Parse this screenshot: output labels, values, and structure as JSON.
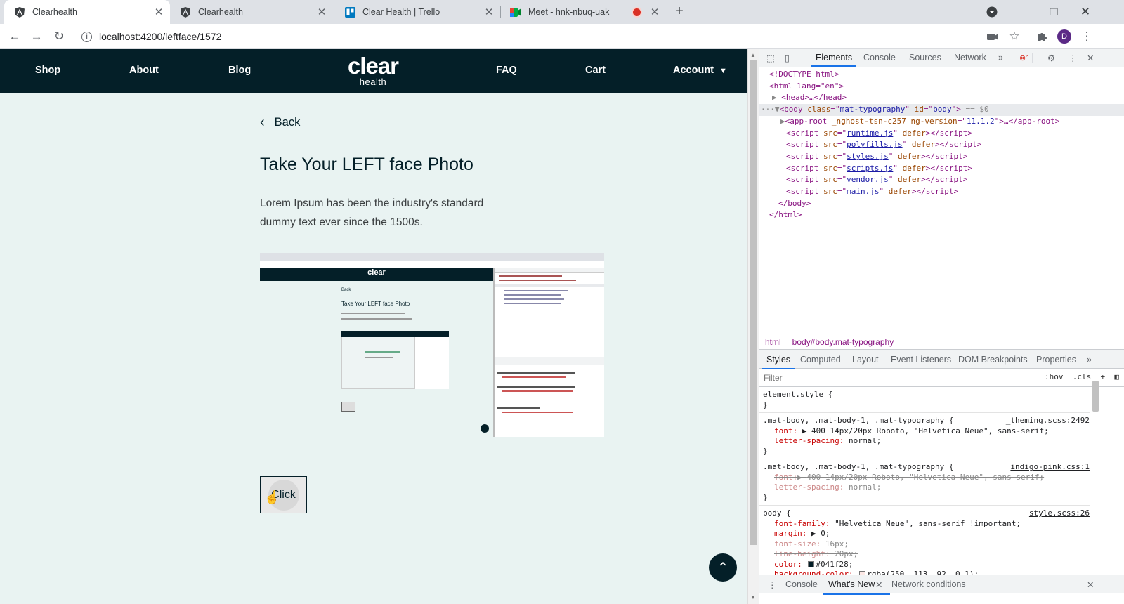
{
  "browser": {
    "tabs": [
      {
        "title": "Clearhealth",
        "active": true
      },
      {
        "title": "Clearhealth",
        "active": false
      },
      {
        "title": "Clear Health | Trello",
        "active": false
      },
      {
        "title": "Meet - hnk-nbuq-uak",
        "active": false,
        "recording": true
      }
    ],
    "url": "localhost:4200/leftface/1572",
    "profile_initial": "D"
  },
  "site": {
    "nav": {
      "shop": "Shop",
      "about": "About",
      "blog": "Blog",
      "logo_main": "clear",
      "logo_sub": "health",
      "faq": "FAQ",
      "cart": "Cart",
      "account": "Account"
    },
    "back_label": "Back",
    "title": "Take Your LEFT face Photo",
    "paragraph": "Lorem Ipsum has been the industry's standard dummy text ever since the 1500s.",
    "click_label": "Click",
    "preview": {
      "title": "Take Your LEFT face Photo",
      "back": "Back"
    }
  },
  "devtools": {
    "tabs": [
      "Elements",
      "Console",
      "Sources",
      "Network"
    ],
    "active_tab": "Elements",
    "error_count": "1",
    "dom": {
      "doctype": "<!DOCTYPE html>",
      "html_open": "<html lang=\"en\">",
      "head": "<head>…</head>",
      "body_class": "mat-typography",
      "body_id": "body",
      "body_marker": "== $0",
      "app_root_attr1": "_nghost-tsn-c257",
      "app_root_attr2_name": "ng-version",
      "app_root_attr2_value": "11.1.2",
      "scripts": [
        "runtime.js",
        "polyfills.js",
        "styles.js",
        "scripts.js",
        "vendor.js",
        "main.js"
      ],
      "body_close": "</body>",
      "html_close": "</html>"
    },
    "breadcrumbs": [
      "html",
      "body#body.mat-typography"
    ],
    "subtabs": [
      "Styles",
      "Computed",
      "Layout",
      "Event Listeners",
      "DOM Breakpoints",
      "Properties"
    ],
    "filter_placeholder": "Filter",
    "filter_hov": ":hov",
    "filter_cls": ".cls",
    "rules": {
      "element_style": "element.style {",
      "r1_selector": ".mat-body, .mat-body-1, .mat-typography {",
      "r1_source": "_theming.scss:2492",
      "r1_font_name": "font:",
      "r1_font_value": "400 14px/20px Roboto, \"Helvetica Neue\", sans-serif;",
      "r1_ls_name": "letter-spacing:",
      "r1_ls_value": "normal;",
      "r2_selector": ".mat-body, .mat-body-1, .mat-typography {",
      "r2_source": "indigo-pink.css:1",
      "r2_font_name": "font:",
      "r2_font_value": "400 14px/20px Roboto, \"Helvetica Neue\", sans-serif;",
      "r2_ls_name": "letter-spacing:",
      "r2_ls_value": "normal;",
      "r3_selector": "body {",
      "r3_source": "style.scss:26",
      "r3_ff_name": "font-family:",
      "r3_ff_value": "\"Helvetica Neue\", sans-serif !important;",
      "r3_margin_name": "margin:",
      "r3_margin_value": "0;",
      "r3_fs_name": "font-size:",
      "r3_fs_value": "16px;",
      "r3_lh_name": "line-height:",
      "r3_lh_value": "20px;",
      "r3_color_name": "color:",
      "r3_color_value": "#041f28;",
      "r3_bg_name": "background-color:",
      "r3_bg_value": "rgba(250, 113, 92, 0.1);",
      "close_brace": "}"
    },
    "drawer_tabs": [
      "Console",
      "What's New",
      "Network conditions"
    ],
    "drawer_active": "What's New"
  },
  "colors": {
    "nav_bg": "#041f28",
    "page_bg": "#e9f3f2",
    "accent": "#1a73e8"
  }
}
